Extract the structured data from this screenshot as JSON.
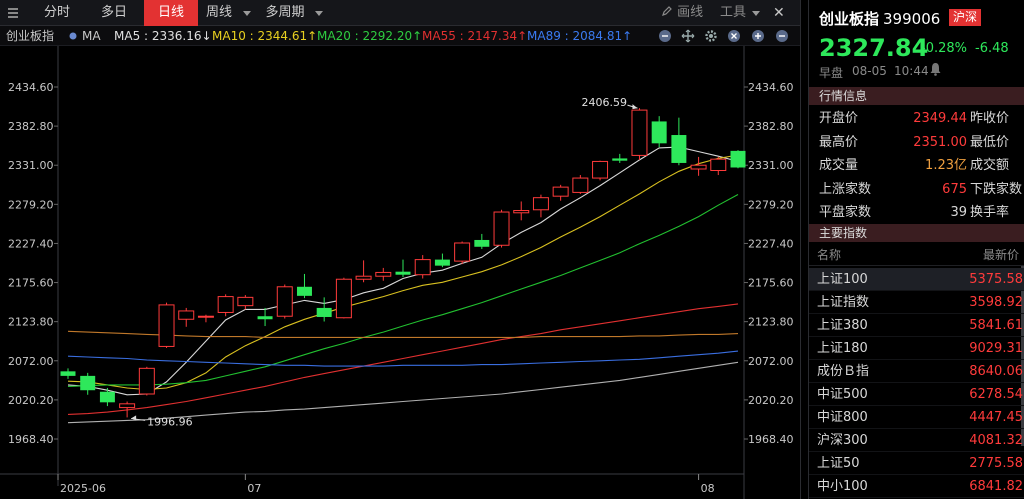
{
  "toolbar": {
    "tabs": [
      {
        "label": "分时",
        "active": false
      },
      {
        "label": "多日",
        "active": false
      },
      {
        "label": "日线",
        "active": true
      },
      {
        "label": "周线",
        "active": false
      },
      {
        "label": "多周期",
        "active": false
      }
    ],
    "draw_label": "画线",
    "tools_label": "工具"
  },
  "ma_row": {
    "index_name": "创业板指",
    "ma_label": "MA",
    "items": [
      {
        "text": "MA5 : 2336.16↓",
        "color": "#e0e0e0"
      },
      {
        "text": "MA10 : 2344.61↑",
        "color": "#e8d020"
      },
      {
        "text": "MA20 : 2292.20↑",
        "color": "#2ecc40"
      },
      {
        "text": "MA55 : 2147.34↑",
        "color": "#e03030"
      },
      {
        "text": "MA89 : 2084.81↑",
        "color": "#3a7af0"
      }
    ]
  },
  "chart_data": {
    "type": "candlestick",
    "y_ticks": [
      "2434.60",
      "2382.80",
      "2331.00",
      "2279.20",
      "2227.40",
      "2175.60",
      "2123.80",
      "2072.00",
      "2020.20",
      "1968.40"
    ],
    "y_range": [
      1968.4,
      2434.6
    ],
    "x_labels": [
      {
        "label": "2025-06",
        "index": 0
      },
      {
        "label": "07",
        "index": 9
      },
      {
        "label": "08",
        "index": 32
      }
    ],
    "annotations": [
      {
        "text": "2406.59",
        "index": 29,
        "value": 2406.59
      },
      {
        "text": "1996.96",
        "index": 3,
        "value": 1996.96
      }
    ],
    "candles": [
      {
        "o": 2058,
        "h": 2062,
        "l": 2048,
        "c": 2052
      },
      {
        "o": 2052,
        "h": 2056,
        "l": 2027,
        "c": 2033
      },
      {
        "o": 2031,
        "h": 2036,
        "l": 2012,
        "c": 2017
      },
      {
        "o": 2010,
        "h": 2018,
        "l": 1997,
        "c": 2015
      },
      {
        "o": 2028,
        "h": 2064,
        "l": 2026,
        "c": 2062
      },
      {
        "o": 2091,
        "h": 2149,
        "l": 2089,
        "c": 2146
      },
      {
        "o": 2127,
        "h": 2142,
        "l": 2117,
        "c": 2138
      },
      {
        "o": 2130,
        "h": 2133,
        "l": 2123,
        "c": 2131
      },
      {
        "o": 2136,
        "h": 2160,
        "l": 2131,
        "c": 2157
      },
      {
        "o": 2145,
        "h": 2159,
        "l": 2140,
        "c": 2156
      },
      {
        "o": 2131,
        "h": 2142,
        "l": 2118,
        "c": 2127
      },
      {
        "o": 2131,
        "h": 2173,
        "l": 2128,
        "c": 2170
      },
      {
        "o": 2170,
        "h": 2187,
        "l": 2155,
        "c": 2158
      },
      {
        "o": 2142,
        "h": 2156,
        "l": 2124,
        "c": 2130
      },
      {
        "o": 2129,
        "h": 2182,
        "l": 2128,
        "c": 2180
      },
      {
        "o": 2180,
        "h": 2205,
        "l": 2176,
        "c": 2184
      },
      {
        "o": 2184,
        "h": 2195,
        "l": 2178,
        "c": 2189
      },
      {
        "o": 2190,
        "h": 2206,
        "l": 2183,
        "c": 2186
      },
      {
        "o": 2186,
        "h": 2212,
        "l": 2181,
        "c": 2206
      },
      {
        "o": 2206,
        "h": 2214,
        "l": 2196,
        "c": 2198
      },
      {
        "o": 2204,
        "h": 2230,
        "l": 2200,
        "c": 2228
      },
      {
        "o": 2232,
        "h": 2240,
        "l": 2220,
        "c": 2223
      },
      {
        "o": 2225,
        "h": 2272,
        "l": 2222,
        "c": 2269
      },
      {
        "o": 2268,
        "h": 2283,
        "l": 2258,
        "c": 2271
      },
      {
        "o": 2272,
        "h": 2292,
        "l": 2262,
        "c": 2288
      },
      {
        "o": 2290,
        "h": 2305,
        "l": 2284,
        "c": 2302
      },
      {
        "o": 2295,
        "h": 2318,
        "l": 2293,
        "c": 2314
      },
      {
        "o": 2314,
        "h": 2337,
        "l": 2311,
        "c": 2336
      },
      {
        "o": 2340,
        "h": 2346,
        "l": 2334,
        "c": 2337
      },
      {
        "o": 2344,
        "h": 2406.59,
        "l": 2338,
        "c": 2404
      },
      {
        "o": 2389,
        "h": 2396,
        "l": 2355,
        "c": 2360
      },
      {
        "o": 2371,
        "h": 2394,
        "l": 2331,
        "c": 2334
      },
      {
        "o": 2326,
        "h": 2342,
        "l": 2317,
        "c": 2331
      },
      {
        "o": 2324,
        "h": 2342,
        "l": 2318,
        "c": 2339
      },
      {
        "o": 2350,
        "h": 2351,
        "l": 2327,
        "c": 2328
      }
    ],
    "ma_series": [
      {
        "name": "MA5",
        "color": "#d8d8d8",
        "values": [
          2040,
          2038,
          2033,
          2027,
          2028,
          2044,
          2070,
          2098,
          2126,
          2140,
          2140,
          2146,
          2152,
          2148,
          2153,
          2162,
          2168,
          2181,
          2188,
          2192,
          2201,
          2209,
          2227,
          2242,
          2255,
          2273,
          2288,
          2304,
          2321,
          2338,
          2354,
          2355,
          2349,
          2343,
          2336
        ]
      },
      {
        "name": "MA10",
        "color": "#d8c020",
        "values": [
          2045,
          2044,
          2040,
          2036,
          2034,
          2036,
          2043,
          2056,
          2077,
          2092,
          2104,
          2117,
          2127,
          2135,
          2143,
          2150,
          2157,
          2165,
          2172,
          2176,
          2183,
          2190,
          2199,
          2210,
          2222,
          2236,
          2249,
          2263,
          2278,
          2293,
          2309,
          2323,
          2333,
          2340,
          2344.6
        ]
      },
      {
        "name": "MA20",
        "color": "#22c030",
        "values": [
          2038,
          2039,
          2040,
          2040,
          2040,
          2041,
          2043,
          2046,
          2052,
          2058,
          2064,
          2072,
          2080,
          2088,
          2095,
          2103,
          2110,
          2118,
          2126,
          2133,
          2141,
          2149,
          2158,
          2167,
          2176,
          2185,
          2195,
          2205,
          2215,
          2227,
          2238,
          2250,
          2263,
          2278,
          2292.2
        ]
      },
      {
        "name": "MA55",
        "color": "#e03030",
        "values": [
          2001,
          2002,
          2004,
          2007,
          2010,
          2014,
          2018,
          2023,
          2028,
          2033,
          2038,
          2044,
          2050,
          2055,
          2060,
          2065,
          2070,
          2075,
          2080,
          2085,
          2090,
          2095,
          2100,
          2104,
          2108,
          2113,
          2117,
          2121,
          2125,
          2129,
          2133,
          2137,
          2141,
          2144,
          2147.3
        ]
      },
      {
        "name": "MA89",
        "color": "#3a6ee0",
        "values": [
          2078,
          2077,
          2076,
          2075,
          2073,
          2072,
          2071,
          2070,
          2069,
          2068,
          2067,
          2066,
          2066,
          2065,
          2065,
          2065,
          2065,
          2066,
          2066,
          2066,
          2066,
          2067,
          2067,
          2068,
          2069,
          2070,
          2071,
          2072,
          2073,
          2074,
          2076,
          2078,
          2080,
          2082,
          2084.8
        ]
      },
      {
        "name": "MA144",
        "color": "#c0782a",
        "values": [
          2111,
          2110,
          2109,
          2108,
          2107,
          2106,
          2105,
          2104,
          2104,
          2104,
          2103,
          2103,
          2103,
          2103,
          2103,
          2103,
          2103,
          2103,
          2103,
          2103,
          2103,
          2103,
          2103,
          2103,
          2104,
          2104,
          2104,
          2104,
          2104,
          2105,
          2105,
          2106,
          2107,
          2107,
          2108
        ]
      },
      {
        "name": "MA250",
        "color": "#b0b0b0",
        "values": [
          1990,
          1991,
          1992,
          1993,
          1994,
          1996,
          1998,
          2000,
          2002,
          2004,
          2005,
          2007,
          2008,
          2010,
          2012,
          2014,
          2016,
          2018,
          2020,
          2022,
          2024,
          2026,
          2028,
          2031,
          2034,
          2037,
          2040,
          2043,
          2046,
          2050,
          2054,
          2058,
          2062,
          2066,
          2070
        ]
      }
    ]
  },
  "panel": {
    "name": "创业板指",
    "code": "399006",
    "badge": "沪深",
    "price": "2327.84",
    "change_pct": "-0.28%",
    "change": "-6.48",
    "session": "早盘",
    "date": "08-05",
    "time": "10:44",
    "market_header": "行情信息",
    "market": [
      {
        "label": "开盘价",
        "value": "2349.44",
        "value_class": "red",
        "label2": "昨收价"
      },
      {
        "label": "最高价",
        "value": "2351.00",
        "value_class": "red",
        "label2": "最低价"
      },
      {
        "label": "成交量",
        "value": "1.23亿",
        "value_class": "orange",
        "label2": "成交额"
      },
      {
        "label": "上涨家数",
        "value": "675",
        "value_class": "red",
        "label2": "下跌家数"
      },
      {
        "label": "平盘家数",
        "value": "39",
        "value_class": "white",
        "label2": "换手率"
      }
    ],
    "indices_header": "主要指数",
    "indices_cols": {
      "name": "名称",
      "price": "最新价"
    },
    "indices": [
      {
        "name": "上证100",
        "price": "5375.58",
        "selected": true
      },
      {
        "name": "上证指数",
        "price": "3598.92",
        "selected": false
      },
      {
        "name": "上证380",
        "price": "5841.61",
        "selected": false
      },
      {
        "name": "上证180",
        "price": "9029.31",
        "selected": false
      },
      {
        "name": "成份Ｂ指",
        "price": "8640.06",
        "selected": false
      },
      {
        "name": "中证500",
        "price": "6278.54",
        "selected": false
      },
      {
        "name": "中证800",
        "price": "4447.45",
        "selected": false
      },
      {
        "name": "沪深300",
        "price": "4081.32",
        "selected": false
      },
      {
        "name": "上证50",
        "price": "2775.58",
        "selected": false
      },
      {
        "name": "中小100",
        "price": "6841.82",
        "selected": false
      }
    ]
  }
}
